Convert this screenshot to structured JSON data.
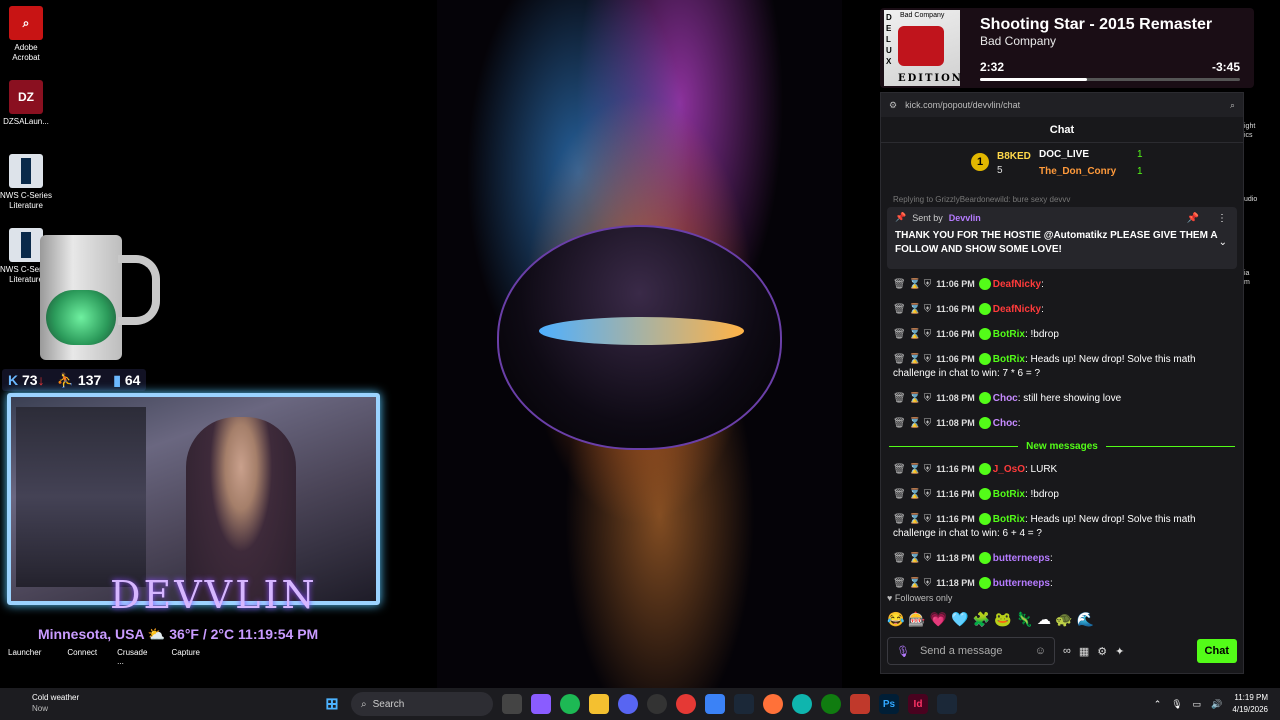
{
  "desktop": {
    "icons": [
      {
        "label": "Adobe Acrobat",
        "icon": "pdf-icon"
      },
      {
        "label": "DZSALaun...",
        "icon": "dzsa-icon"
      },
      {
        "label": "NWS C-Series Literature",
        "icon": "literature-icon"
      },
      {
        "label": "NWS C-Series Literature",
        "icon": "literature-icon"
      }
    ],
    "bottom_labels": [
      "Launcher",
      "Connect",
      "Crusade ...",
      "Capture"
    ],
    "right_labels": [
      "ight",
      "ics",
      "udio",
      "ia",
      "m"
    ]
  },
  "overlay": {
    "stats": {
      "a": "73",
      "b": "137",
      "c": "64"
    },
    "brand": "DEVVLIN",
    "weather_line": "Minnesota, USA  ⛅  36°F / 2°C  11:19:54 PM"
  },
  "now_playing": {
    "title": "Shooting Star - 2015 Remaster",
    "artist": "Bad Company",
    "current": "2:32",
    "remaining": "-3:45",
    "progress_fraction": 0.41,
    "cover_top": "Bad Company",
    "cover_side": "DELUX",
    "cover_edition": "EDITION"
  },
  "chat": {
    "url": "kick.com/popout/devvlin/chat",
    "header": "Chat",
    "leaderboard": {
      "rank": "1",
      "first_user": "B8KED",
      "first_count": "5",
      "second_user": "DOC_LIVE",
      "second_count": "1",
      "third_user": "The_Don_Conry",
      "third_count": "1"
    },
    "reply_text": "Replying to GrizzlyBeardonewild: bure sexy devvv",
    "pinned": {
      "label": "Sent by",
      "user": "Devvlin",
      "text": "THANK YOU FOR THE HOSTIE @Automatikz PLEASE GIVE THEM A FOLLOW AND SHOW SOME LOVE!"
    },
    "messages": [
      {
        "time": "11:06 PM",
        "user": "DeafNicky",
        "text": "",
        "color": "#ff3b3b"
      },
      {
        "time": "11:06 PM",
        "user": "DeafNicky",
        "text": "",
        "color": "#ff3b3b"
      },
      {
        "time": "11:06 PM",
        "user": "BotRix",
        "text": "!bdrop",
        "color": "#53fc18"
      },
      {
        "time": "11:06 PM",
        "user": "BotRix",
        "text": "Heads up! New drop!  Solve this math challenge in chat to win: 7 * 6 = ?",
        "color": "#53fc18"
      },
      {
        "time": "11:08 PM",
        "user": "Choc",
        "text": "still here showing love",
        "color": "#c68bff"
      },
      {
        "time": "11:08 PM",
        "user": "Choc",
        "text": "",
        "color": "#c68bff"
      }
    ],
    "new_messages_label": "New messages",
    "messages_new": [
      {
        "time": "11:16 PM",
        "user": "J_OsO",
        "text": "LURK",
        "color": "#ff3b3b"
      },
      {
        "time": "11:16 PM",
        "user": "BotRix",
        "text": "!bdrop",
        "color": "#53fc18"
      },
      {
        "time": "11:16 PM",
        "user": "BotRix",
        "text": "Heads up! New drop!  Solve this math challenge in chat to win: 6 + 4 = ?",
        "color": "#53fc18"
      },
      {
        "time": "11:18 PM",
        "user": "butterneeps",
        "text": "",
        "color": "#b57bff"
      },
      {
        "time": "11:18 PM",
        "user": "butterneeps",
        "text": "",
        "color": "#b57bff"
      }
    ],
    "followers_only": "Followers only",
    "input_placeholder": "Send a message",
    "send_button": "Chat"
  },
  "taskbar": {
    "weather_title": "Cold weather",
    "weather_sub": "Now",
    "search_placeholder": "Search",
    "time": "11:19 PM",
    "date": "4/19/2026"
  }
}
